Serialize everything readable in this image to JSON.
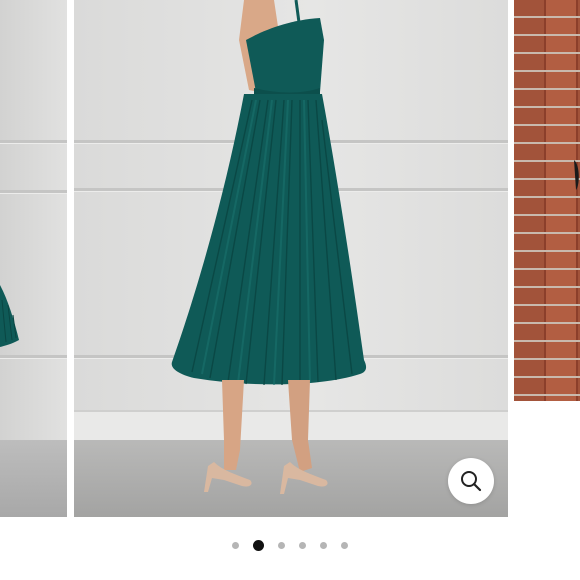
{
  "carousel": {
    "slide_count": 6,
    "active_index": 1,
    "slides": [
      {
        "name": "studio-side"
      },
      {
        "name": "studio-profile"
      },
      {
        "name": "brick-wall"
      }
    ]
  },
  "product": {
    "dress_color": "#0f5a57",
    "shoe_color": "#d9b8a0"
  },
  "controls": {
    "zoom_icon": "magnifier-icon",
    "indicator_active_color": "#111111",
    "indicator_inactive_color": "#b5b5b5"
  }
}
